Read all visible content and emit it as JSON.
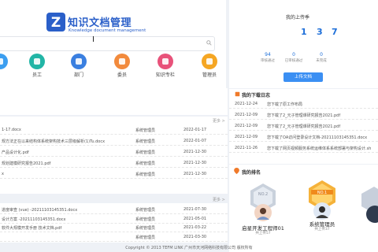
{
  "brand": {
    "title": "知识文档管理",
    "subtitle": "Knowledge document management",
    "logo_letter": "Z",
    "color": "#2a5fc9"
  },
  "tiles": [
    {
      "label": "",
      "color": "#3b9ef0",
      "icon": "home-icon"
    },
    {
      "label": "员工",
      "color": "#22b5a6",
      "icon": "user-icon"
    },
    {
      "label": "部门",
      "color": "#3a7fe0",
      "icon": "department-icon"
    },
    {
      "label": "委员",
      "color": "#f28a3c",
      "icon": "member-icon"
    },
    {
      "label": "知识专栏",
      "color": "#e8527a",
      "icon": "column-icon"
    },
    {
      "label": "管理员",
      "color": "#f5a623",
      "icon": "tag-icon"
    }
  ],
  "docs": {
    "more": "更多 >",
    "rows": [
      {
        "name": "1-17.docx",
        "dept": "系统管理员",
        "date": "2022-01-17"
      },
      {
        "name": "规方法正在以来结构体系统架构技术三层级解析(1)Tu.docx",
        "dept": "系统管理员",
        "date": "2022-01-07"
      },
      {
        "name": "产品设计化.pdf",
        "dept": "系统管理员",
        "date": "2021-12-30"
      },
      {
        "name": "规划建模研究报告2021.pdf",
        "dept": "系统管理员",
        "date": "2021-12-30"
      },
      {
        "name": "x",
        "dept": "系统管理员",
        "date": "2021-12-30"
      }
    ]
  },
  "docs2": {
    "more": "更多 >",
    "rows": [
      {
        "name": "进度审查 (vue) -20211103145351.docx",
        "dept": "系统管理员",
        "date": "2021-07-30"
      },
      {
        "name": "设计方案 -20211103145351.docx",
        "dept": "系统管理员",
        "date": "2021-05-01"
      },
      {
        "name": "软件大规模开发手册 技术文档.pdf",
        "dept": "系统管理员",
        "date": "2021-03-22"
      },
      {
        "name": "",
        "dept": "系统管理员",
        "date": "2021-03-30"
      }
    ]
  },
  "uploads": {
    "title": "我的上传季",
    "nums": [
      "1",
      "3",
      "7"
    ],
    "stats": [
      {
        "num": "94",
        "label": "审核通过"
      },
      {
        "num": "0",
        "label": "已审核通过"
      },
      {
        "num": "0",
        "label": "未完成"
      }
    ],
    "button": "上传文档"
  },
  "downloads": {
    "title": "我的下载日志",
    "rows": [
      {
        "date": "2021-12-24",
        "text": "您下载了原工作布局"
      },
      {
        "date": "2021-12-09",
        "text": "您下载了2_元子管理课研究报告2021.pdf"
      },
      {
        "date": "2021-12-09",
        "text": "您下载了2_元子管理课研究报告2021.pdf"
      },
      {
        "date": "2021-12-09",
        "text": "您下载了OA访问登录设计文档-20211103145351.docx"
      },
      {
        "date": "2021-11-26",
        "text": "您下载了网页视频服务系统运维体系系统部署与架构设计.sh"
      }
    ]
  },
  "ranking": {
    "title": "我的排名",
    "people": [
      {
        "name": "启星开发工程师01",
        "sub": "共上传57",
        "badge": "NO.2"
      },
      {
        "name": "系统管理员",
        "sub": "共上传37",
        "badge": "NO.1"
      }
    ]
  },
  "footer": "Copyright © 2013 TEFM LINK 广州市天河网络科技有限公司 版权所有"
}
